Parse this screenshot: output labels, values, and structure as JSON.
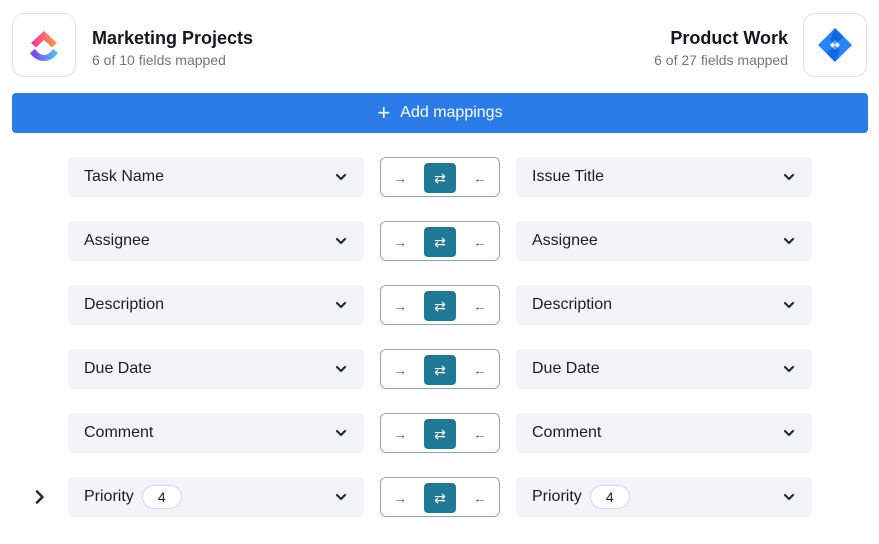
{
  "source": {
    "name": "Marketing Projects",
    "fields_mapped": "6 of 10 fields mapped",
    "logo_icon": "clickup-logo-icon"
  },
  "target": {
    "name": "Product Work",
    "fields_mapped": "6 of 27 fields mapped",
    "logo_icon": "jira-logo-icon"
  },
  "add_mappings": {
    "icon": "plus-icon",
    "label": "Add mappings",
    "color": "#2b7be9"
  },
  "direction_labels": {
    "left_to_right": "→",
    "both": "⇄",
    "right_to_left": "←",
    "active_color": "#1e7a96"
  },
  "mappings": [
    {
      "left": "Task Name",
      "right": "Issue Title",
      "direction": "both"
    },
    {
      "left": "Assignee",
      "right": "Assignee",
      "direction": "both"
    },
    {
      "left": "Description",
      "right": "Description",
      "direction": "both"
    },
    {
      "left": "Due Date",
      "right": "Due Date",
      "direction": "both"
    },
    {
      "left": "Comment",
      "right": "Comment",
      "direction": "both"
    },
    {
      "left": "Priority",
      "left_badge": "4",
      "right": "Priority",
      "right_badge": "4",
      "direction": "both",
      "expandable": true
    }
  ]
}
